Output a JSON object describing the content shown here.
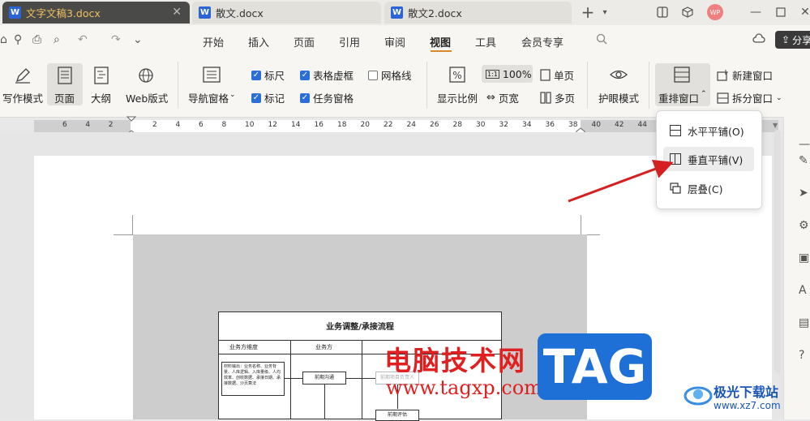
{
  "tabs": [
    {
      "label": "文字文稿3.docx",
      "active": true
    },
    {
      "label": "散文.docx",
      "active": false
    },
    {
      "label": "散文2.docx",
      "active": false
    }
  ],
  "window": {
    "add_tab": "+",
    "avatar_initials": "WP"
  },
  "menu": {
    "items": [
      "开始",
      "插入",
      "页面",
      "引用",
      "审阅",
      "视图",
      "工具",
      "会员专享"
    ],
    "active": "视图",
    "share_label": "分享"
  },
  "ribbon": {
    "write_mode": "写作模式",
    "page": "页面",
    "outline": "大纲",
    "web_layout": "Web版式",
    "nav_pane": "导航窗格",
    "checks": [
      {
        "label": "标尺",
        "checked": true
      },
      {
        "label": "表格虚框",
        "checked": true
      },
      {
        "label": "网格线",
        "checked": false
      },
      {
        "label": "标记",
        "checked": true
      },
      {
        "label": "任务窗格",
        "checked": true
      }
    ],
    "zoom_ratio": "显示比例",
    "zoom_100": "100%",
    "zoom_100_icon": "1:1",
    "single_page": "单页",
    "page_width": "页宽",
    "multi_page": "多页",
    "eye_mode": "护眼模式",
    "rearrange": "重排窗口",
    "new_window": "新建窗口",
    "split_window": "拆分窗口"
  },
  "ruler": {
    "ticks": [
      "6",
      "4",
      "2",
      "2",
      "4",
      "6",
      "8",
      "10",
      "12",
      "14",
      "16",
      "18",
      "20",
      "22",
      "24",
      "26",
      "28",
      "30",
      "32",
      "34",
      "36",
      "38",
      "40",
      "42",
      "44",
      "46"
    ]
  },
  "dropdown": {
    "items": [
      {
        "label": "水平平铺(O)",
        "highlight": false
      },
      {
        "label": "垂直平铺(V)",
        "highlight": true
      },
      {
        "label": "层叠(C)",
        "highlight": false
      }
    ]
  },
  "document": {
    "flow_title": "业务调整/承接流程",
    "col1": "业务方维度",
    "col2": "业务方",
    "box_text": "材料输出：业务名称、业务背景、人库逻辑、入库量级、人均效率、创收数据、承接日期、承接数据、沙页算法",
    "box2": "前期沟通",
    "box3": "前期项目负责人",
    "box4": "前期评估"
  },
  "watermark": {
    "cn": "电脑技术网",
    "url": "www.tagxp.com",
    "tag": "TAG",
    "site": "极光下载站",
    "site_url": "www.xz7.com"
  }
}
